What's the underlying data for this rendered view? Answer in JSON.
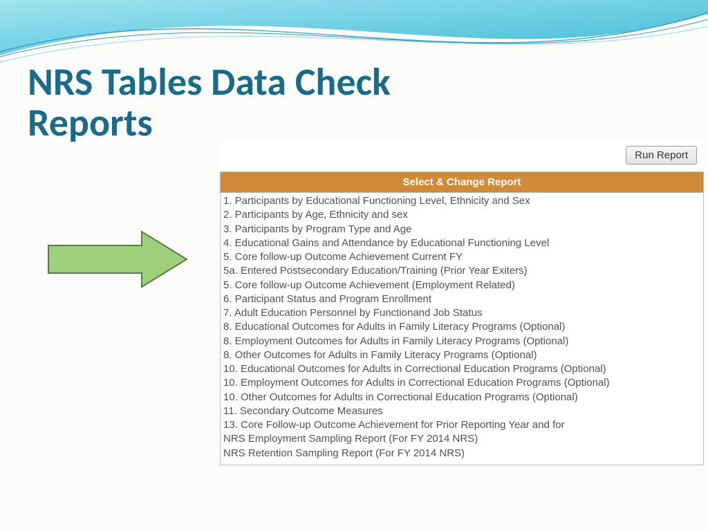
{
  "slide": {
    "title": "NRS Tables Data Check Reports"
  },
  "panel": {
    "run_label": "Run Report",
    "header": "Select & Change Report",
    "items": [
      "1. Participants by Educational Functioning Level, Ethnicity and Sex",
      "2. Participants by Age, Ethnicity and sex",
      "3. Participants by Program Type and Age",
      "4. Educational Gains and Attendance by Educational Functioning Level",
      "5. Core follow-up Outcome Achievement Current FY",
      "5a. Entered Postsecondary Education/Training (Prior Year Exiters)",
      "5. Core follow-up Outcome Achievement (Employment Related)",
      "6. Participant Status and Program Enrollment",
      "7. Adult Education Personnel by Functionand Job Status",
      "8. Educational Outcomes for Adults in Family Literacy Programs (Optional)",
      "8. Employment Outcomes for Adults in Family Literacy Programs (Optional)",
      "8. Other Outcomes for Adults in Family Literacy Programs (Optional)",
      "10. Educational Outcomes for Adults in Correctional Education Programs (Optional)",
      "10. Employment Outcomes for Adults in Correctional Education Programs (Optional)",
      "10. Other Outcomes for Adults in Correctional Education Programs (Optional)",
      "11. Secondary Outcome Measures",
      "13. Core Follow-up Outcome Achievement for Prior Reporting Year and for",
      "NRS Employment Sampling Report (For FY 2014 NRS)",
      "NRS Retention Sampling Report (For FY 2014 NRS)"
    ]
  }
}
